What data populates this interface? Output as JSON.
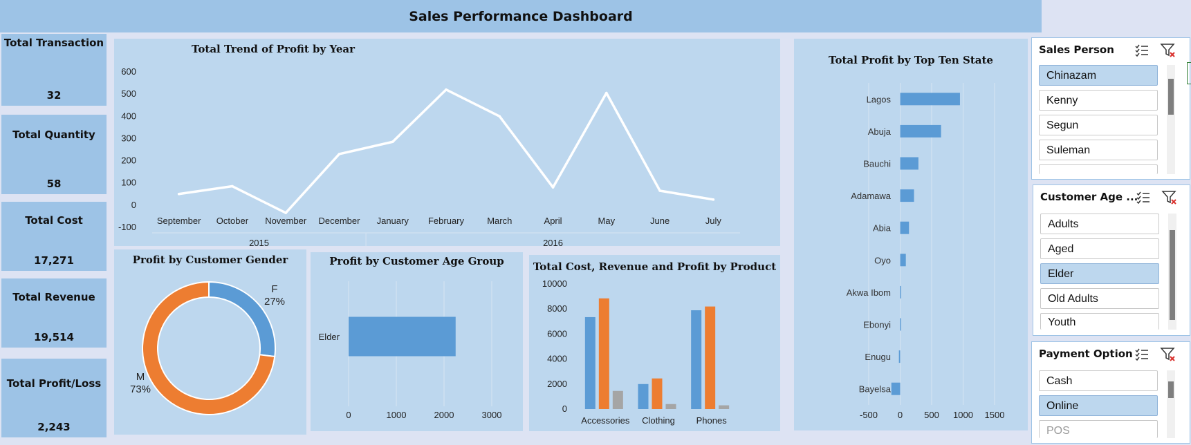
{
  "header": {
    "title": "Sales Performance Dashboard"
  },
  "kpis": [
    {
      "label": "Total Transaction",
      "value": "32"
    },
    {
      "label": "Total Quantity",
      "value": "58"
    },
    {
      "label": "Total Cost",
      "value": "17,271"
    },
    {
      "label": "Total Revenue",
      "value": "19,514"
    },
    {
      "label": "Total Profit/Loss",
      "value": "2,243"
    }
  ],
  "slicers": {
    "sales_person": {
      "title": "Sales Person",
      "items": [
        "Chinazam",
        "Kenny",
        "Segun",
        "Suleman"
      ],
      "selected": [
        "Chinazam"
      ]
    },
    "customer_age": {
      "title": "Customer Age ...",
      "items": [
        "Adults",
        "Aged",
        "Elder",
        "Old Adults",
        "Youth"
      ],
      "selected": [
        "Elder"
      ]
    },
    "payment": {
      "title": "Payment Option",
      "items": [
        "Cash",
        "Online",
        "POS"
      ],
      "selected": [
        "Online"
      ]
    }
  },
  "colors": {
    "blue": "#5b9bd5",
    "orange": "#ed7d31",
    "gray": "#a5a5a5",
    "line": "#ffffff",
    "panel": "#bdd7ee",
    "header": "#9dc3e6"
  },
  "chart_data": [
    {
      "type": "line",
      "title": "Total Trend of Profit by Year",
      "categories": [
        "September",
        "October",
        "November",
        "December",
        "January",
        "February",
        "March",
        "April",
        "May",
        "June",
        "July"
      ],
      "groups": [
        {
          "label": "2015",
          "span": 4
        },
        {
          "label": "2016",
          "span": 7
        }
      ],
      "values": [
        50,
        85,
        -35,
        230,
        285,
        520,
        400,
        80,
        505,
        65,
        25
      ],
      "ylim": [
        -100,
        600
      ],
      "yticks": [
        -100,
        0,
        100,
        200,
        300,
        400,
        500,
        600
      ],
      "grid": false
    },
    {
      "type": "pie",
      "title": "Profit by Customer Gender",
      "labels": [
        "F",
        "M"
      ],
      "values": [
        27,
        73
      ],
      "display": [
        "27%",
        "73%"
      ],
      "donut": true
    },
    {
      "type": "bar",
      "title": "Profit by Customer Age Group",
      "orientation": "horizontal",
      "categories": [
        "Elder"
      ],
      "values": [
        2243
      ],
      "xlim": [
        0,
        3000
      ],
      "xticks": [
        0,
        1000,
        2000,
        3000
      ]
    },
    {
      "type": "bar",
      "title": "Total Cost, Revenue and Profit by Product",
      "categories": [
        "Accessories",
        "Clothing",
        "Phones"
      ],
      "series": [
        {
          "values": [
            7350,
            2000,
            7900
          ]
        },
        {
          "values": [
            8850,
            2450,
            8200
          ]
        },
        {
          "values": [
            1450,
            400,
            300
          ]
        }
      ],
      "ylim": [
        0,
        10000
      ],
      "yticks": [
        0,
        2000,
        4000,
        6000,
        8000,
        10000
      ]
    },
    {
      "type": "bar",
      "title": "Total Profit by Top Ten State",
      "orientation": "horizontal",
      "categories": [
        "Lagos",
        "Abuja",
        "Bauchi",
        "Adamawa",
        "Abia",
        "Oyo",
        "Akwa Ibom",
        "Ebonyi",
        "Enugu",
        "Bayelsa"
      ],
      "values": [
        950,
        650,
        290,
        220,
        140,
        90,
        10,
        10,
        -20,
        -140
      ],
      "xlim": [
        -500,
        1500
      ],
      "xticks": [
        -500,
        0,
        500,
        1000,
        1500
      ]
    }
  ]
}
